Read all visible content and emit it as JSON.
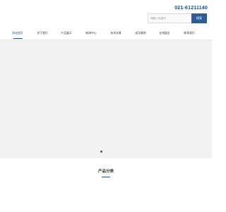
{
  "header": {
    "phone": "021-61211140",
    "search": {
      "placeholder": "请输入关键词",
      "button_label": "搜索"
    }
  },
  "nav": {
    "items": [
      {
        "label": "网站首页"
      },
      {
        "label": "关于我们"
      },
      {
        "label": "产品展示"
      },
      {
        "label": "新闻中心"
      },
      {
        "label": "技术文章"
      },
      {
        "label": "成功案例"
      },
      {
        "label": "在线留言"
      },
      {
        "label": "联系我们"
      }
    ],
    "active_index": 0
  },
  "banner": {
    "slide_count": 1,
    "active_slide": 1
  },
  "section": {
    "title": "产品分类"
  },
  "colors": {
    "accent": "#1f4e8c",
    "button": "#2f5c97",
    "banner_bg": "#f2f2f2"
  }
}
